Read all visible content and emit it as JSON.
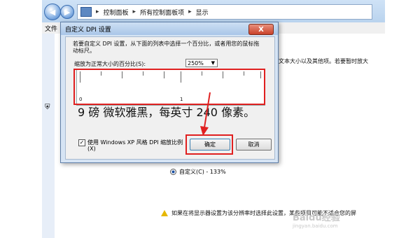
{
  "explorer": {
    "breadcrumb": [
      "控制面板",
      "所有控制面板项",
      "显示"
    ],
    "menu_file": "文件",
    "bg_text_right": "文本大小以及其他项。若要暂时放大",
    "radio_custom": "自定义(C) - 133%",
    "warning": "如果在将显示器设置为该分辨率时选择此设置，某些项目可能不适合您的屏"
  },
  "dialog": {
    "title": "自定义 DPI 设置",
    "close": "X",
    "description": "若要自定义 DPI 设置，从下面的列表中选择一个百分比，或者用您的鼠标拖动标尺。",
    "scale_label": "缩放为正常大小的百分比(S):",
    "scale_value": "250%",
    "ruler_start": "0",
    "ruler_mid": "1",
    "sample_text": "9 磅 微软雅黑，每英寸 240 像素。",
    "checkbox_label": "使用 Windows XP 风格 DPI 缩放比例(X)",
    "checkbox_checked": true,
    "ok": "确定",
    "cancel": "取消"
  },
  "watermark": {
    "text": "Baidu经验",
    "sub": "jingyan.baidu.com"
  },
  "colors": {
    "highlight": "#e02020",
    "titlebar": "#a9c6e8"
  }
}
